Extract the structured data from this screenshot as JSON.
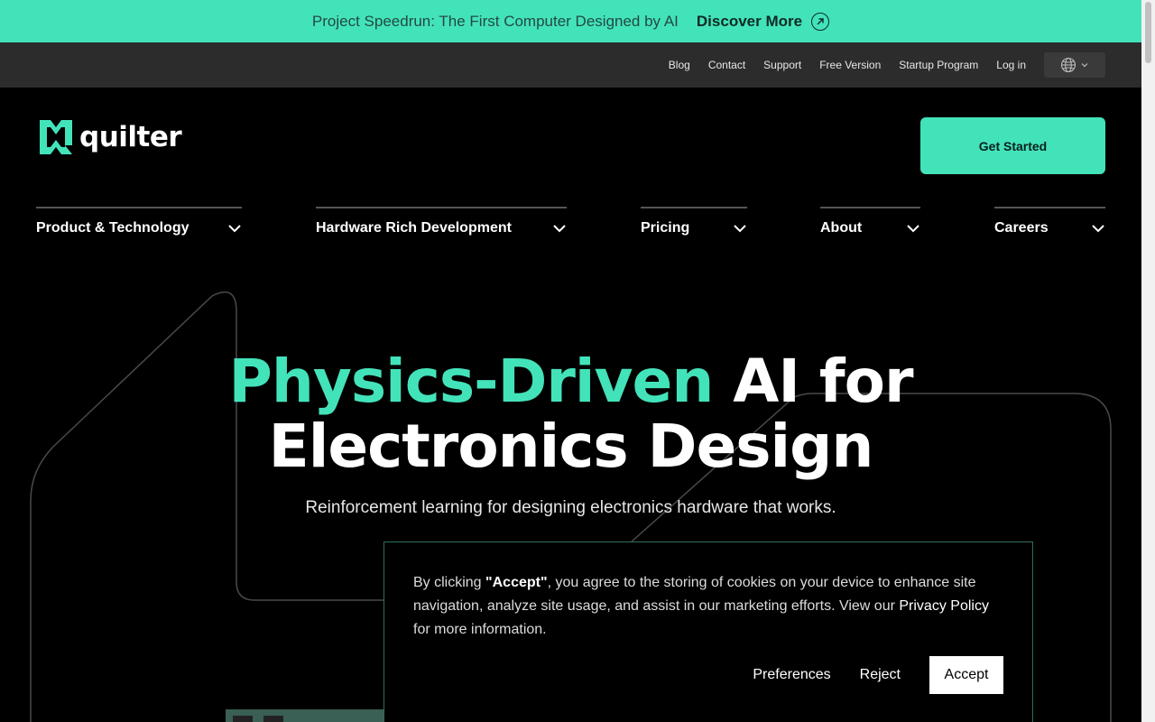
{
  "announcement": {
    "message": "Project Speedrun: The First Computer Designed by AI",
    "cta": "Discover More"
  },
  "utility_nav": {
    "links": [
      "Blog",
      "Contact",
      "Support",
      "Free Version",
      "Startup Program",
      "Log in"
    ]
  },
  "header": {
    "logo_text": "quilter",
    "cta": "Get Started"
  },
  "main_nav": {
    "items": [
      {
        "label": "Product & Technology"
      },
      {
        "label": "Hardware Rich Development"
      },
      {
        "label": "Pricing"
      },
      {
        "label": "About"
      },
      {
        "label": "Careers"
      }
    ]
  },
  "hero": {
    "title_accent": "Physics-Driven",
    "title_rest": " AI for",
    "title_line2": "Electronics Design",
    "subtitle": "Reinforcement learning for designing electronics hardware that works."
  },
  "cookie": {
    "text_pre": "By clicking ",
    "text_bold": "\"Accept\"",
    "text_mid": ", you agree to the storing of cookies on your device to enhance site navigation, analyze site usage, and assist in our marketing efforts. View our ",
    "link": "Privacy Policy",
    "text_post": " for more information.",
    "preferences": "Preferences",
    "reject": "Reject",
    "accept": "Accept"
  },
  "colors": {
    "accent": "#43e3ba",
    "background": "#000000",
    "utility_bar": "#2c2c2c"
  }
}
